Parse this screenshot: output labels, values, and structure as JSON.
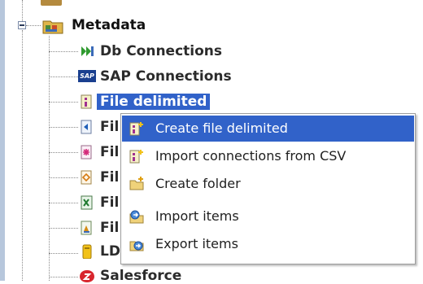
{
  "tree": {
    "root": {
      "label": "Metadata",
      "icon": "metadata-folder-icon"
    },
    "items": [
      {
        "label": "Db Connections",
        "icon": "db-connections-icon"
      },
      {
        "label": "SAP Connections",
        "icon": "sap-icon"
      },
      {
        "label": "File delimited",
        "icon": "file-delimited-icon",
        "selected": true
      },
      {
        "label": "Fil",
        "icon": "file-positional-icon"
      },
      {
        "label": "Fil",
        "icon": "file-regex-icon"
      },
      {
        "label": "Fil",
        "icon": "file-xml-icon"
      },
      {
        "label": "Fil",
        "icon": "file-excel-icon"
      },
      {
        "label": "Fil",
        "icon": "file-ldif-icon"
      },
      {
        "label": "LD",
        "icon": "ldap-icon"
      },
      {
        "label": "Salesforce",
        "icon": "salesforce-icon"
      }
    ]
  },
  "context_menu": {
    "items": [
      {
        "label": "Create file delimited",
        "icon": "create-file-delimited-icon",
        "highlighted": true
      },
      {
        "label": "Import connections from CSV",
        "icon": "import-csv-icon"
      },
      {
        "label": "Create folder",
        "icon": "create-folder-icon"
      },
      {
        "label": "Import items",
        "icon": "import-items-icon"
      },
      {
        "label": "Export items",
        "icon": "export-items-icon"
      }
    ]
  },
  "colors": {
    "selection": "#3162c9",
    "tree_text": "#2b2b2b"
  }
}
